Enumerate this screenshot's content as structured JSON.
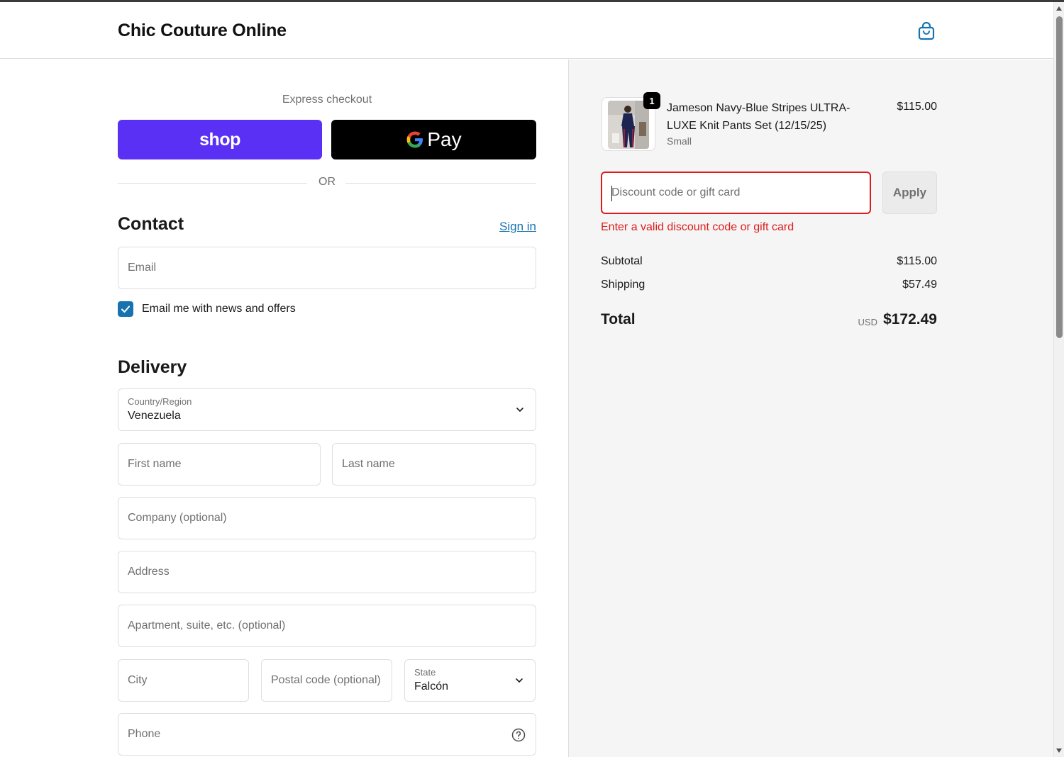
{
  "header": {
    "brand": "Chic Couture Online",
    "cart_icon": "shopping-bag-icon"
  },
  "express": {
    "label": "Express checkout",
    "shop_label": "shop",
    "gpay_label": "Pay",
    "or_label": "OR",
    "colors": {
      "shop": "#5a31f4",
      "gpay": "#000000"
    }
  },
  "contact": {
    "heading": "Contact",
    "signin_label": "Sign in",
    "email_placeholder": "Email",
    "newsletter_label": "Email me with news and offers",
    "newsletter_checked": true
  },
  "delivery": {
    "heading": "Delivery",
    "country_label": "Country/Region",
    "country_value": "Venezuela",
    "first_name_placeholder": "First name",
    "last_name_placeholder": "Last name",
    "company_placeholder": "Company (optional)",
    "address_placeholder": "Address",
    "apartment_placeholder": "Apartment, suite, etc. (optional)",
    "city_placeholder": "City",
    "postal_placeholder": "Postal code (optional)",
    "state_label": "State",
    "state_value": "Falcón",
    "phone_placeholder": "Phone"
  },
  "order": {
    "quantity": "1",
    "product_name": "Jameson Navy-Blue Stripes ULTRA-LUXE Knit Pants Set (12/15/25)",
    "variant": "Small",
    "price": "$115.00",
    "discount_placeholder": "Discount code or gift card",
    "apply_label": "Apply",
    "discount_error": "Enter a valid discount code or gift card",
    "subtotal_label": "Subtotal",
    "subtotal_value": "$115.00",
    "shipping_label": "Shipping",
    "shipping_value": "$57.49",
    "total_label": "Total",
    "currency": "USD",
    "total_value": "$172.49",
    "colors": {
      "error": "#dd1d1d",
      "link": "#1773b0"
    }
  }
}
